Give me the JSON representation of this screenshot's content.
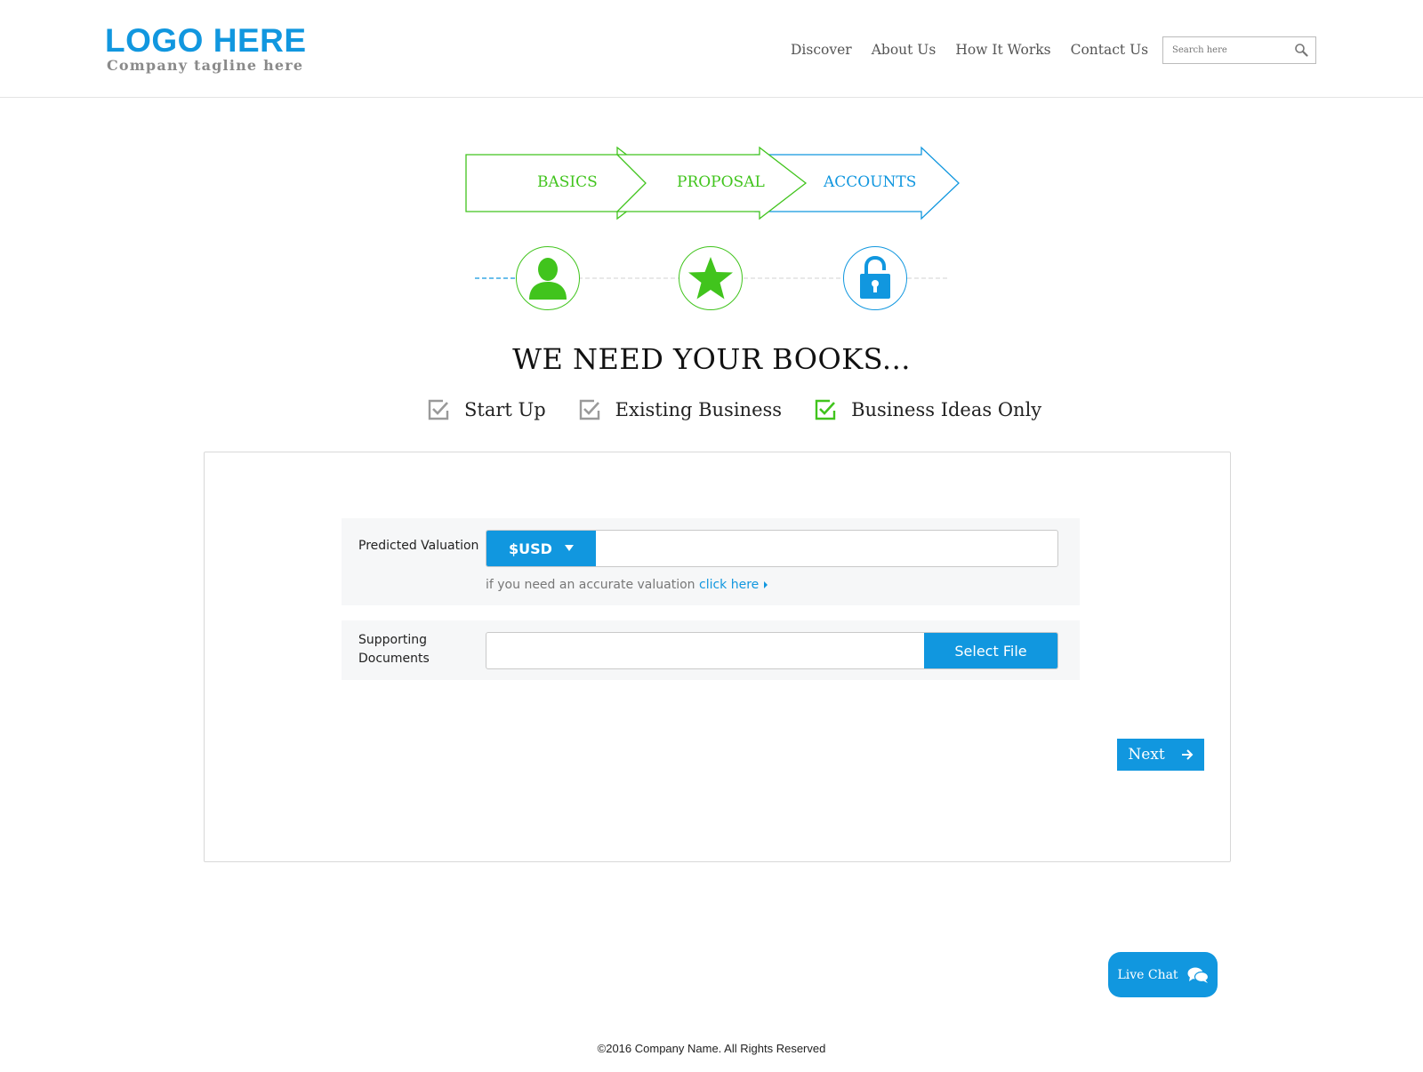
{
  "header": {
    "logo": "LOGO HERE",
    "tagline": "Company tagline here",
    "nav": [
      "Discover",
      "About Us",
      "How It Works",
      "Contact Us"
    ],
    "search_placeholder": "Search here"
  },
  "steps": {
    "items": [
      {
        "label": "BASICS",
        "color": "#41c41d",
        "icon": "user-icon"
      },
      {
        "label": "PROPOSAL",
        "color": "#41c41d",
        "icon": "star-icon"
      },
      {
        "label": "ACCOUNTS",
        "color": "#1197df",
        "icon": "unlock-icon"
      }
    ]
  },
  "page_title": "WE NEED YOUR BOOKS...",
  "options": [
    {
      "label": "Start Up",
      "checked_color": "#9a9a9a"
    },
    {
      "label": "Existing Business",
      "checked_color": "#9a9a9a"
    },
    {
      "label": "Business Ideas Only",
      "checked_color": "#41c41d"
    }
  ],
  "form": {
    "valuation_label": "Predicted Valuation",
    "currency": "$USD",
    "valuation_value": "",
    "hint_text": "if you need an accurate valuation",
    "hint_link": "click here",
    "docs_label_1": "Supporting",
    "docs_label_2": "Documents",
    "file_value": "",
    "select_file": "Select File",
    "next": "Next"
  },
  "live_chat": "Live Chat",
  "footer": "©2016 Company Name. All Rights Reserved",
  "colors": {
    "accent": "#1197df",
    "green": "#41c41d"
  }
}
